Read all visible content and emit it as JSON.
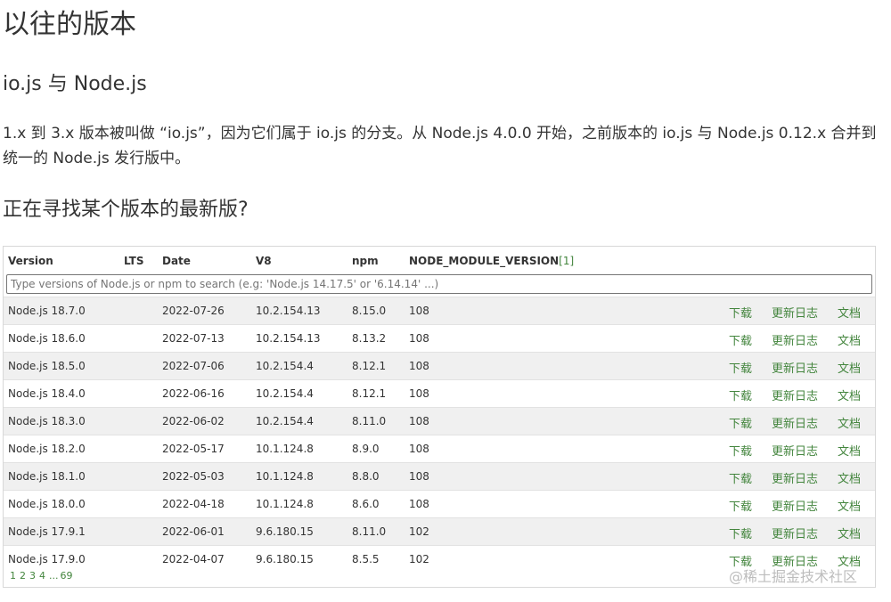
{
  "page": {
    "title": "以往的版本",
    "subtitle": "io.js 与 Node.js",
    "description": "1.x 到 3.x 版本被叫做 “io.js”，因为它们属于 io.js 的分支。从 Node.js 4.0.0 开始，之前版本的 io.js 与 Node.js 0.12.x 合并到统一的 Node.js 发行版中。",
    "section_title": "正在寻找某个版本的最新版?"
  },
  "table": {
    "headers": {
      "version": "Version",
      "lts": "LTS",
      "date": "Date",
      "v8": "V8",
      "npm": "npm",
      "module": "NODE_MODULE_VERSION",
      "module_ref": "[1]"
    },
    "search_placeholder": "Type versions of Node.js or npm to search (e.g: 'Node.js 14.17.5' or '6.14.14' ...)",
    "link_labels": {
      "download": "下载",
      "changelog": "更新日志",
      "docs": "文档"
    },
    "rows": [
      {
        "version": "Node.js 18.7.0",
        "lts": "",
        "date": "2022-07-26",
        "v8": "10.2.154.13",
        "npm": "8.15.0",
        "module": "108"
      },
      {
        "version": "Node.js 18.6.0",
        "lts": "",
        "date": "2022-07-13",
        "v8": "10.2.154.13",
        "npm": "8.13.2",
        "module": "108"
      },
      {
        "version": "Node.js 18.5.0",
        "lts": "",
        "date": "2022-07-06",
        "v8": "10.2.154.4",
        "npm": "8.12.1",
        "module": "108"
      },
      {
        "version": "Node.js 18.4.0",
        "lts": "",
        "date": "2022-06-16",
        "v8": "10.2.154.4",
        "npm": "8.12.1",
        "module": "108"
      },
      {
        "version": "Node.js 18.3.0",
        "lts": "",
        "date": "2022-06-02",
        "v8": "10.2.154.4",
        "npm": "8.11.0",
        "module": "108"
      },
      {
        "version": "Node.js 18.2.0",
        "lts": "",
        "date": "2022-05-17",
        "v8": "10.1.124.8",
        "npm": "8.9.0",
        "module": "108"
      },
      {
        "version": "Node.js 18.1.0",
        "lts": "",
        "date": "2022-05-03",
        "v8": "10.1.124.8",
        "npm": "8.8.0",
        "module": "108"
      },
      {
        "version": "Node.js 18.0.0",
        "lts": "",
        "date": "2022-04-18",
        "v8": "10.1.124.8",
        "npm": "8.6.0",
        "module": "108"
      },
      {
        "version": "Node.js 17.9.1",
        "lts": "",
        "date": "2022-06-01",
        "v8": "9.6.180.15",
        "npm": "8.11.0",
        "module": "102"
      },
      {
        "version": "Node.js 17.9.0",
        "lts": "",
        "date": "2022-04-07",
        "v8": "9.6.180.15",
        "npm": "8.5.5",
        "module": "102"
      }
    ]
  },
  "pager": {
    "pages": [
      "1",
      "2",
      "3",
      "4",
      "...",
      "69"
    ]
  },
  "watermark": "@稀土掘金技术社区",
  "colors": {
    "link": "#43853d",
    "row_alt": "#f0f0f0",
    "text": "#333333"
  }
}
